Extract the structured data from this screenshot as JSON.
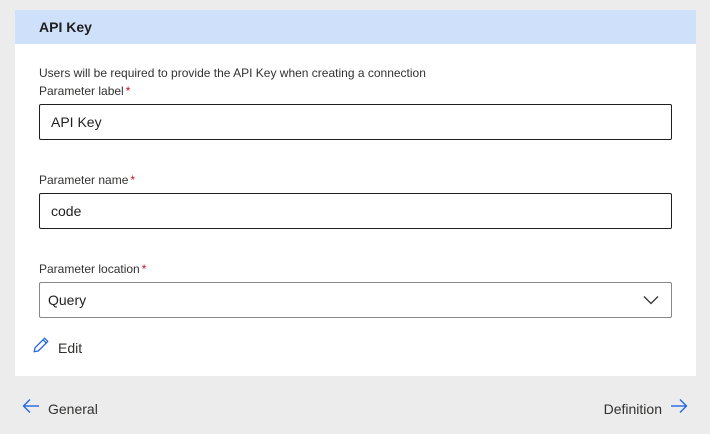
{
  "panel": {
    "title": "API Key",
    "description": "Users will be required to provide the API Key when creating a connection"
  },
  "fields": {
    "parameter_label": {
      "label": "Parameter label",
      "required_mark": "*",
      "value": "API Key"
    },
    "parameter_name": {
      "label": "Parameter name",
      "required_mark": "*",
      "value": "code"
    },
    "parameter_location": {
      "label": "Parameter location",
      "required_mark": "*",
      "selected": "Query"
    }
  },
  "actions": {
    "edit_label": "Edit"
  },
  "navigation": {
    "back_label": "General",
    "next_label": "Definition"
  },
  "colors": {
    "header_bg": "#cfe0fb",
    "accent": "#2266e3",
    "required": "#c50f1f",
    "page_bg": "#ececec"
  },
  "icons": {
    "edit": "pencil-icon",
    "dropdown": "chevron-down-icon",
    "back": "arrow-left-icon",
    "next": "arrow-right-icon"
  }
}
